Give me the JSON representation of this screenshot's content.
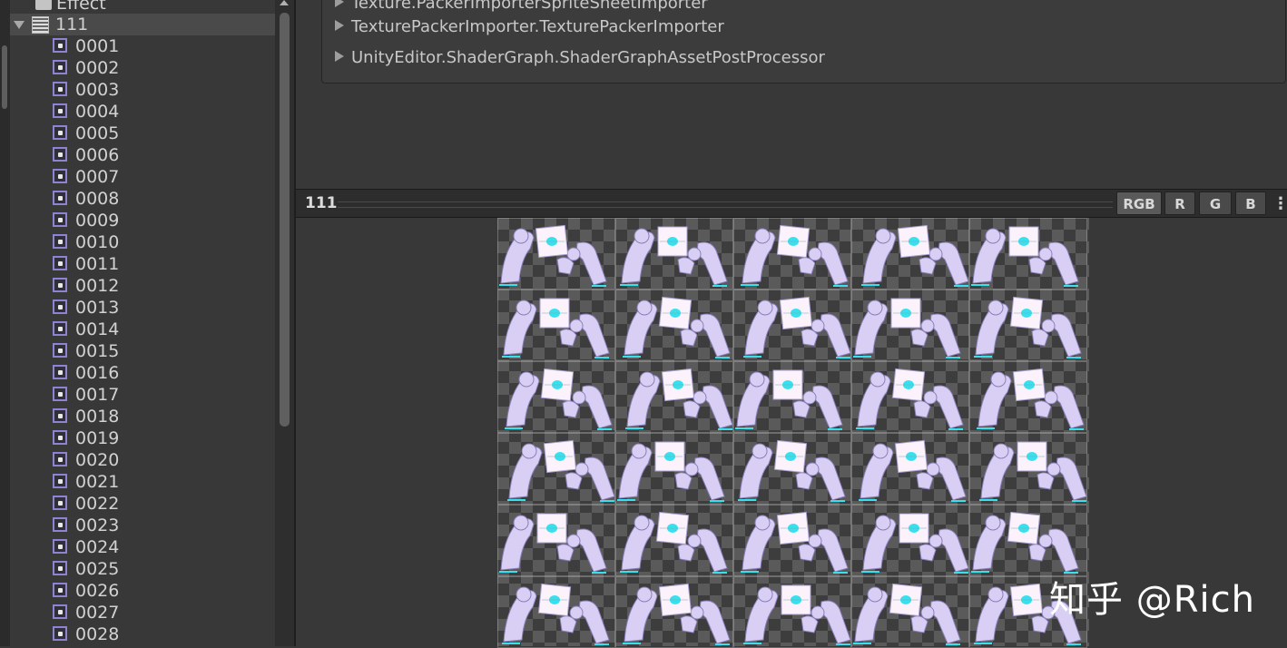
{
  "project": {
    "folder_label": "Effect",
    "sheet_label": "111",
    "sprites": [
      "0001",
      "0002",
      "0003",
      "0004",
      "0005",
      "0006",
      "0007",
      "0008",
      "0009",
      "0010",
      "0011",
      "0012",
      "0013",
      "0014",
      "0015",
      "0016",
      "0017",
      "0018",
      "0019",
      "0020",
      "0021",
      "0022",
      "0023",
      "0024",
      "0025",
      "0026",
      "0027",
      "0028"
    ]
  },
  "inspector": {
    "processors": [
      "Texture.PackerImporterSpriteSheetImporter",
      "TexturePackerImporter.TexturePackerImporter",
      "UnityEditor.ShaderGraph.ShaderGraphAssetPostProcessor"
    ]
  },
  "preview": {
    "title": "111",
    "channels": [
      "RGB",
      "R",
      "G",
      "B"
    ],
    "active_channel": "RGB",
    "menu_icon": "kebab-menu-icon",
    "grid": {
      "columns": 5,
      "rows_visible": 6
    }
  },
  "watermark": "知乎 @Rich",
  "colors": {
    "sprite_tint": "#d9cff5",
    "accent_cyan": "#38e0ee",
    "icon_purple": "#8e85d2"
  }
}
